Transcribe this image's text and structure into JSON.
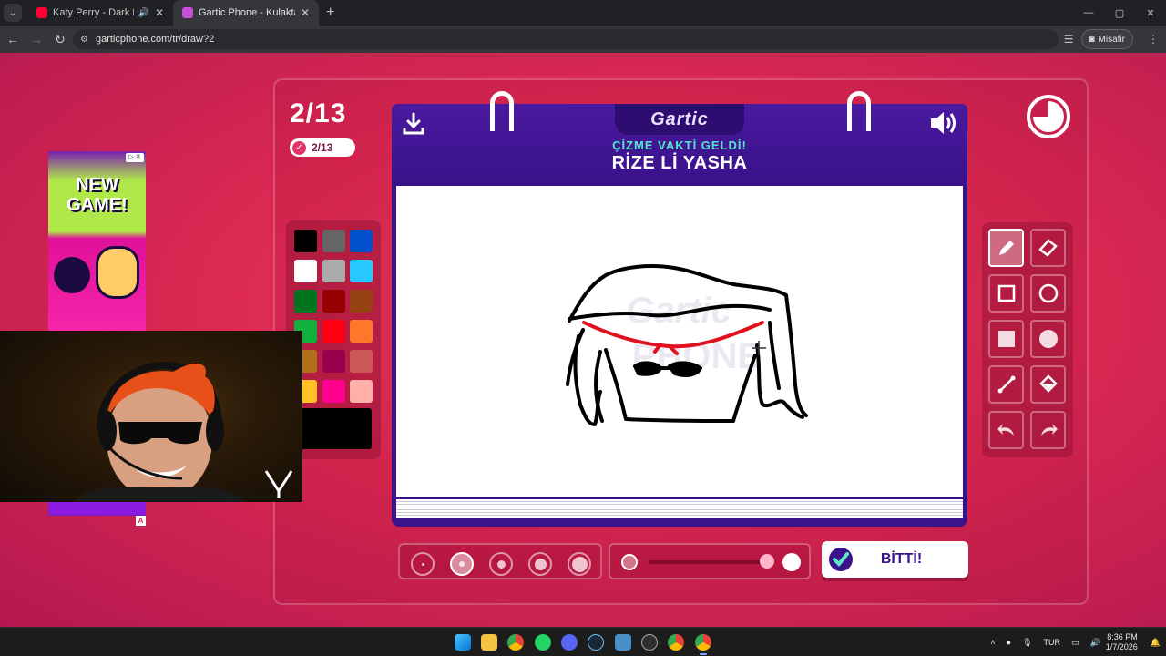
{
  "browser": {
    "tabs": [
      {
        "title": "Katy Perry - Dark Horse ft. J",
        "favicon_color": "#ff0033"
      },
      {
        "title": "Gartic Phone - Kulaktan Kulağa",
        "favicon_color": "#c94fd6"
      }
    ],
    "url": "garticphone.com/tr/draw?2",
    "profile_label": "Misafir"
  },
  "game": {
    "round_big": "2/13",
    "round_small": "2/13",
    "logo": "Gartic",
    "subtitle": "ÇİZME VAKTİ GELDİ!",
    "word": "RİZE Lİ YASHA",
    "done_label": "BİTTİ!"
  },
  "palette": {
    "colors": [
      "#000000",
      "#666666",
      "#0050cd",
      "#ffffff",
      "#aaaaaa",
      "#26c9ff",
      "#017420",
      "#990000",
      "#964112",
      "#11b03c",
      "#ff0013",
      "#ff7829",
      "#b0701c",
      "#99004e",
      "#cb5a57",
      "#ffc126",
      "#ff008f",
      "#feafa8"
    ],
    "current": "#000000"
  },
  "tools": [
    "pen-icon",
    "eraser-icon",
    "rect-outline-icon",
    "ellipse-outline-icon",
    "rect-fill-icon",
    "ellipse-fill-icon",
    "line-icon",
    "fill-bucket-icon",
    "undo-icon",
    "redo-icon"
  ],
  "brush": {
    "selected_size": 2,
    "opacity": 1.0
  },
  "ad": {
    "title": "NEW GAME!",
    "mark": "A"
  },
  "taskbar": {
    "language": "TUR",
    "time": "8:36 PM",
    "date": "1/7/2026"
  }
}
